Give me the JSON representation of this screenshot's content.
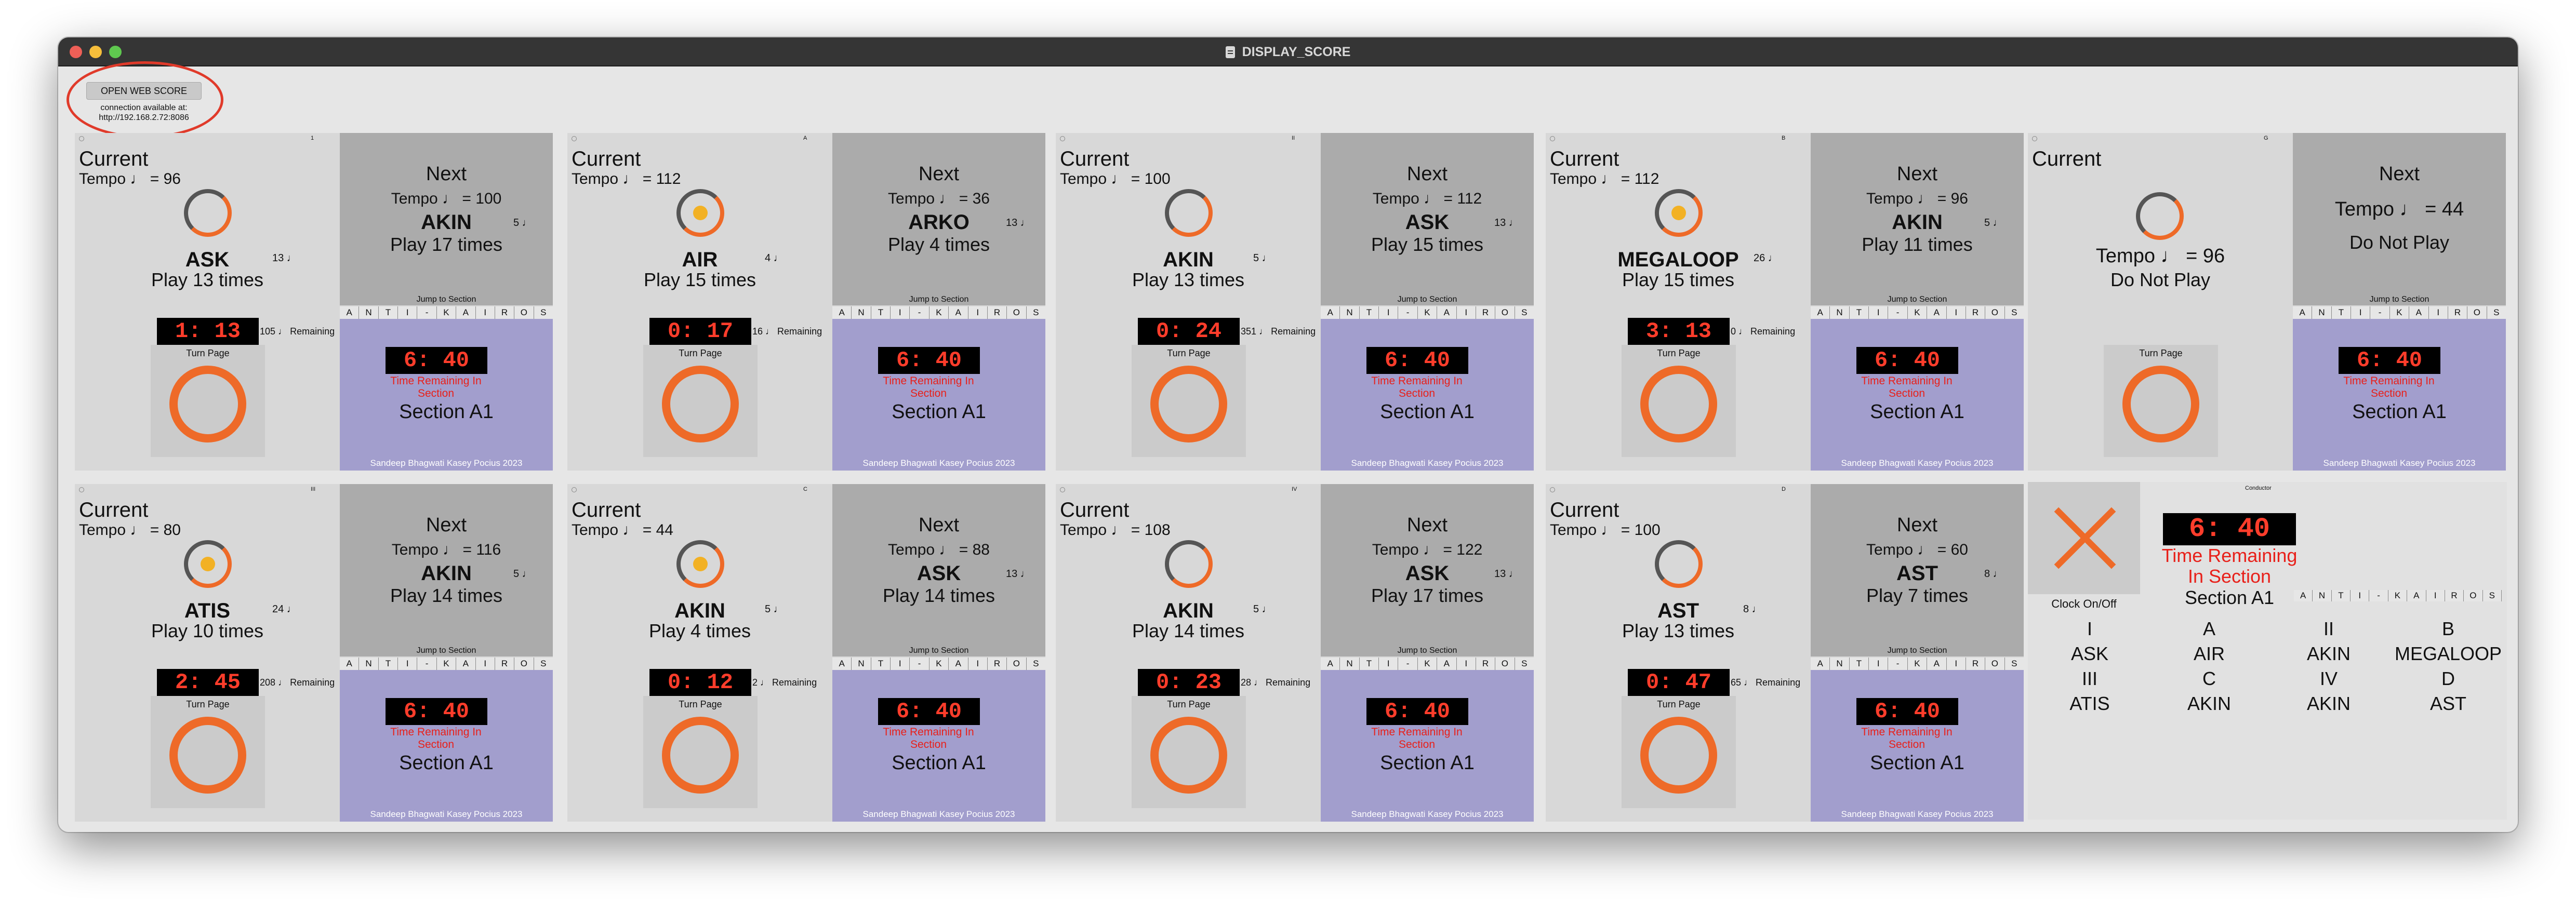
{
  "window": {
    "title": "DISPLAY_SCORE",
    "traffic_lights": [
      "#ee5f57",
      "#f6be3b",
      "#5fc84f"
    ]
  },
  "toolbar": {
    "open_web_score_label": "OPEN WEB SCORE",
    "connection_line1": "connection available at:",
    "connection_line2": "http://192.168.2.72:8086"
  },
  "labels": {
    "current": "Current",
    "next": "Next",
    "jump": "Jump to Section",
    "turn_page": "Turn Page",
    "remaining_suffix": "♩ Remaining",
    "time_remaining": "Time Remaining In Section",
    "section": "Section A1",
    "credit": "Sandeep Bhagwati Kasey Pocius 2023"
  },
  "section_letters": [
    "A",
    "N",
    "T",
    "I",
    "-",
    "K",
    "A",
    "I",
    "R",
    "O",
    "S"
  ],
  "colors": {
    "accent": "#ee6a28",
    "timer_text": "#ff3d2b",
    "next_bg": "#ababab",
    "section_bg": "#a29ecd",
    "panel_bg": "#d8d8d8"
  },
  "players": [
    {
      "pg": "1",
      "cur_tempo": "Tempo ♩ = 96",
      "cur_name": "ASK",
      "cur_play": "Play 13 times",
      "cur_notes": "13 ♩",
      "metro_on": false,
      "remaining_time": "1: 13",
      "remaining": "105",
      "next_tempo": "Tempo ♩ = 100",
      "next_name": "AKIN",
      "next_play": "Play 17 times",
      "next_notes": "5 ♩",
      "section_time": "6: 40"
    },
    {
      "pg": "A",
      "cur_tempo": "Tempo ♩ = 112",
      "cur_name": "AIR",
      "cur_play": "Play 15 times",
      "cur_notes": "4 ♩",
      "metro_on": true,
      "remaining_time": "0: 17",
      "remaining": "16",
      "next_tempo": "Tempo ♩ = 36",
      "next_name": "ARKO",
      "next_play": "Play 4 times",
      "next_notes": "13 ♩",
      "section_time": "6: 40"
    },
    {
      "pg": "II",
      "cur_tempo": "Tempo ♩ = 100",
      "cur_name": "AKIN",
      "cur_play": "Play 13 times",
      "cur_notes": "5 ♩",
      "metro_on": false,
      "remaining_time": "0: 24",
      "remaining": "351",
      "next_tempo": "Tempo ♩ = 112",
      "next_name": "ASK",
      "next_play": "Play 15 times",
      "next_notes": "13 ♩",
      "section_time": "6: 40"
    },
    {
      "pg": "B",
      "cur_tempo": "Tempo ♩ = 112",
      "cur_name": "MEGALOOP",
      "cur_play": "Play 15 times",
      "cur_notes": "26 ♩",
      "metro_on": true,
      "remaining_time": "3: 13",
      "remaining": "0",
      "next_tempo": "Tempo ♩ = 96",
      "next_name": "AKIN",
      "next_play": "Play 11 times",
      "next_notes": "5 ♩",
      "section_time": "6: 40"
    },
    {
      "pg": "III",
      "cur_tempo": "Tempo ♩ = 80",
      "cur_name": "ATIS",
      "cur_play": "Play 10 times",
      "cur_notes": "24 ♩",
      "metro_on": true,
      "remaining_time": "2: 45",
      "remaining": "208",
      "next_tempo": "Tempo ♩ = 116",
      "next_name": "AKIN",
      "next_play": "Play 14 times",
      "next_notes": "5 ♩",
      "section_time": "6: 40"
    },
    {
      "pg": "C",
      "cur_tempo": "Tempo ♩ = 44",
      "cur_name": "AKIN",
      "cur_play": "Play 4 times",
      "cur_notes": "5 ♩",
      "metro_on": true,
      "remaining_time": "0: 12",
      "remaining": "2",
      "next_tempo": "Tempo ♩ = 88",
      "next_name": "ASK",
      "next_play": "Play 14 times",
      "next_notes": "13 ♩",
      "section_time": "6: 40"
    },
    {
      "pg": "IV",
      "cur_tempo": "Tempo ♩ = 108",
      "cur_name": "AKIN",
      "cur_play": "Play 14 times",
      "cur_notes": "5 ♩",
      "metro_on": false,
      "remaining_time": "0: 23",
      "remaining": "28",
      "next_tempo": "Tempo ♩ = 122",
      "next_name": "ASK",
      "next_play": "Play 17 times",
      "next_notes": "13 ♩",
      "section_time": "6: 40"
    },
    {
      "pg": "D",
      "cur_tempo": "Tempo ♩ = 100",
      "cur_name": "AST",
      "cur_play": "Play 13 times",
      "cur_notes": "8 ♩",
      "metro_on": false,
      "remaining_time": "0: 47",
      "remaining": "65",
      "next_tempo": "Tempo ♩ = 60",
      "next_name": "AST",
      "next_play": "Play 7 times",
      "next_notes": "8 ♩",
      "section_time": "6: 40"
    }
  ],
  "special": {
    "pg": "G",
    "cur_tempo": "Tempo ♩ = 96",
    "cur_play": "Do Not Play",
    "next_tempo": "Tempo ♩ = 44",
    "next_play": "Do Not Play",
    "section_time": "6: 40"
  },
  "conductor": {
    "title": "Conductor",
    "clock_label": "Clock On/Off",
    "time": "6: 40",
    "time_remaining": "Time Remaining In Section",
    "section": "Section A1",
    "grid": [
      [
        "I",
        "A",
        "II",
        "B"
      ],
      [
        "ASK",
        "AIR",
        "AKIN",
        "MEGALOOP"
      ],
      [
        "III",
        "C",
        "IV",
        "D"
      ],
      [
        "ATIS",
        "AKIN",
        "AKIN",
        "AST"
      ]
    ]
  }
}
